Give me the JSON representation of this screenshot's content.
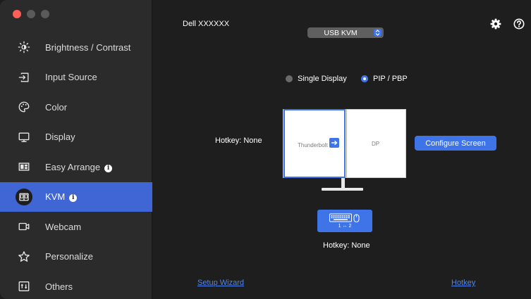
{
  "sidebar": {
    "items": [
      {
        "label": "Brightness / Contrast",
        "icon": "brightness-icon",
        "active": false,
        "info": false
      },
      {
        "label": "Input Source",
        "icon": "input-source-icon",
        "active": false,
        "info": false
      },
      {
        "label": "Color",
        "icon": "color-palette-icon",
        "active": false,
        "info": false
      },
      {
        "label": "Display",
        "icon": "display-icon",
        "active": false,
        "info": false
      },
      {
        "label": "Easy Arrange",
        "icon": "easy-arrange-icon",
        "active": false,
        "info": true
      },
      {
        "label": "KVM",
        "icon": "kvm-icon",
        "active": true,
        "info": true
      },
      {
        "label": "Webcam",
        "icon": "webcam-icon",
        "active": false,
        "info": false
      },
      {
        "label": "Personalize",
        "icon": "star-icon",
        "active": false,
        "info": false
      },
      {
        "label": "Others",
        "icon": "others-icon",
        "active": false,
        "info": false
      }
    ]
  },
  "main": {
    "monitor_name": "Dell XXXXXX",
    "mode_select": {
      "value": "USB KVM"
    },
    "radio_single": "Single Display",
    "radio_pip": "PIP / PBP",
    "selected_mode": "PIP / PBP",
    "hotkey_left": "Hotkey: None",
    "pane_left_label": "Thunderbolt",
    "pane_right_label": "DP",
    "configure_button": "Configure Screen",
    "kbm_switch_text": "1 ↔ 2",
    "hotkey_center": "Hotkey: None",
    "setup_wizard_link": "Setup Wizard",
    "hotkey_link": "Hotkey"
  },
  "colors": {
    "accent": "#3f73e8",
    "sidebar_active": "#3f66d4",
    "background": "#1e1e1e",
    "sidebar": "#2b2b2b"
  }
}
